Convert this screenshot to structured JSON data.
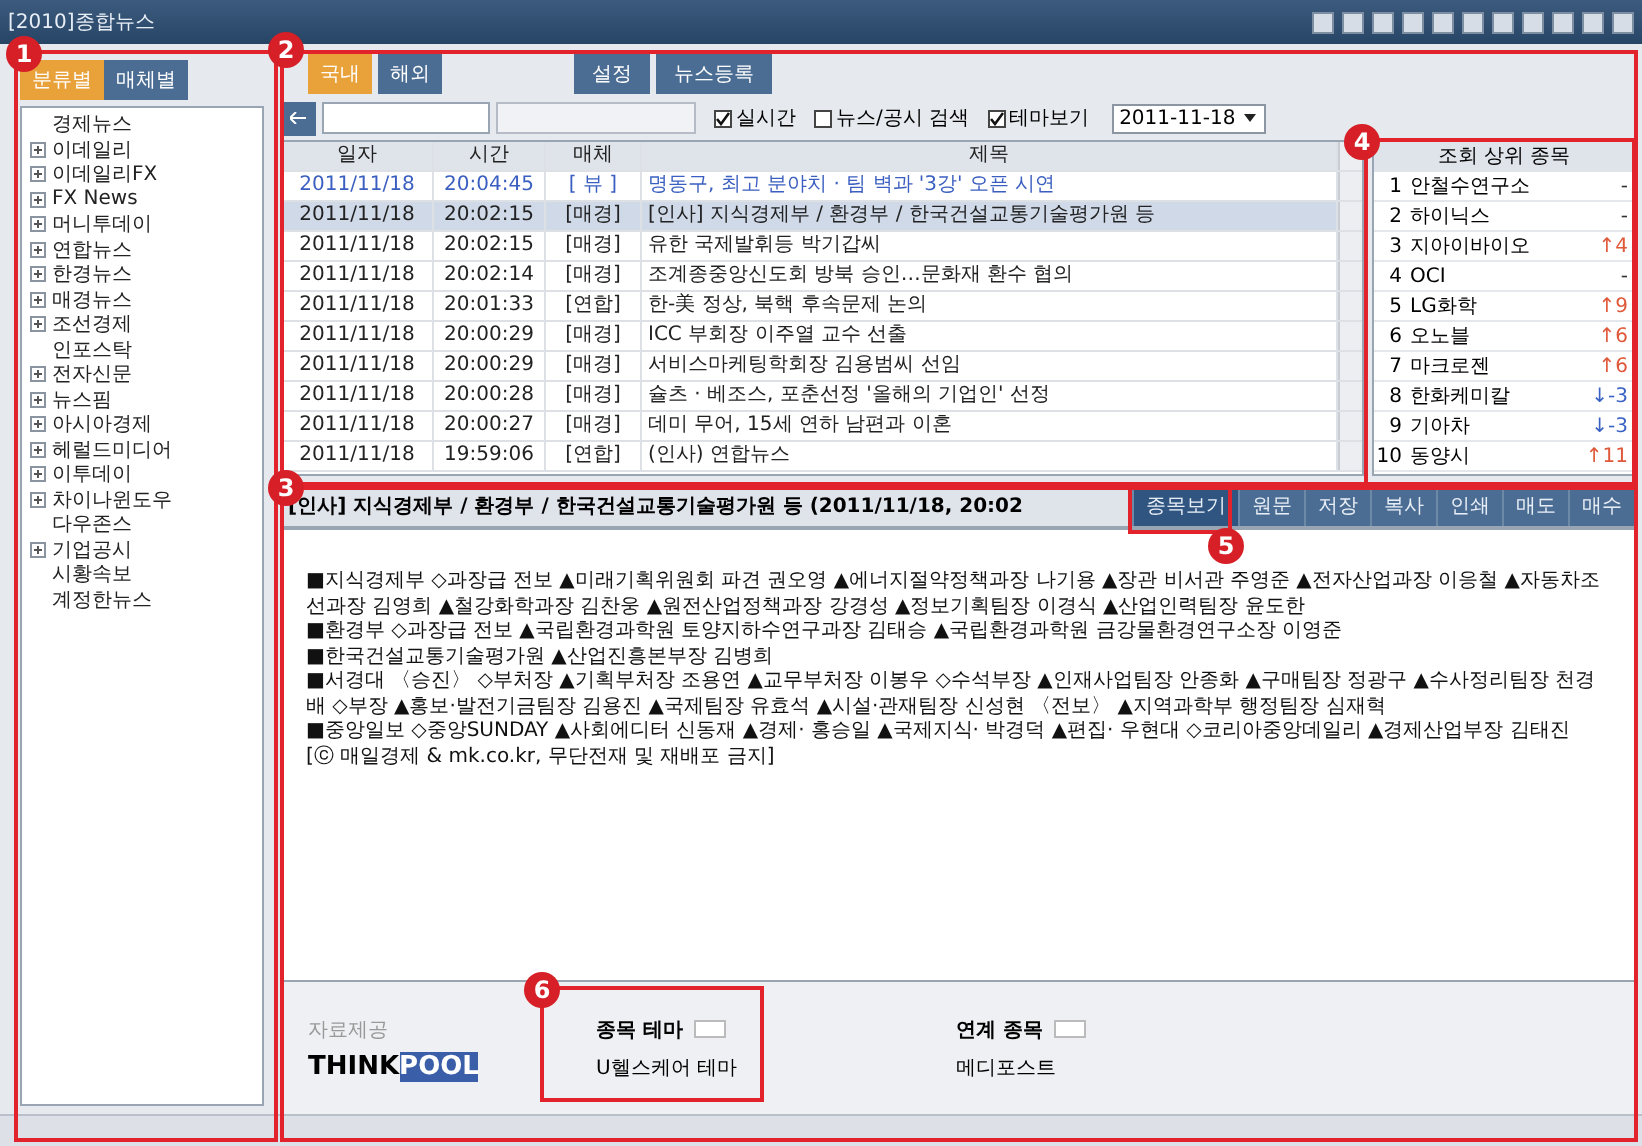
{
  "window": {
    "title": "[2010]종합뉴스"
  },
  "sidebar": {
    "tabs": [
      {
        "label": "분류별",
        "selected": true
      },
      {
        "label": "매체별",
        "selected": false
      }
    ],
    "items": [
      {
        "label": "경제뉴스",
        "expandable": false
      },
      {
        "label": "이데일리",
        "expandable": true
      },
      {
        "label": "이데일리FX",
        "expandable": true
      },
      {
        "label": "FX News",
        "expandable": true
      },
      {
        "label": "머니투데이",
        "expandable": true
      },
      {
        "label": "연합뉴스",
        "expandable": true
      },
      {
        "label": "한경뉴스",
        "expandable": true
      },
      {
        "label": "매경뉴스",
        "expandable": true
      },
      {
        "label": "조선경제",
        "expandable": true
      },
      {
        "label": "인포스탁",
        "expandable": false
      },
      {
        "label": "전자신문",
        "expandable": true
      },
      {
        "label": "뉴스핌",
        "expandable": true
      },
      {
        "label": "아시아경제",
        "expandable": true
      },
      {
        "label": "헤럴드미디어",
        "expandable": true
      },
      {
        "label": "이투데이",
        "expandable": true
      },
      {
        "label": "차이나윈도우",
        "expandable": true
      },
      {
        "label": "다우존스",
        "expandable": false
      },
      {
        "label": "기업공시",
        "expandable": true
      },
      {
        "label": "시황속보",
        "expandable": false
      },
      {
        "label": "계정한뉴스",
        "expandable": false
      }
    ]
  },
  "toolbar": {
    "tabs": [
      {
        "label": "국내",
        "selected": true
      },
      {
        "label": "해외",
        "selected": false
      }
    ],
    "buttons": [
      "설정",
      "뉴스등록"
    ],
    "checkboxes": [
      {
        "label": "실시간",
        "checked": true
      },
      {
        "label": "뉴스/공시 검색",
        "checked": false
      },
      {
        "label": "테마보기",
        "checked": true
      }
    ],
    "date": "2011-11-18"
  },
  "news_table": {
    "columns": [
      "일자",
      "시간",
      "매체",
      "제목"
    ],
    "rows": [
      {
        "date": "2011/11/18",
        "time": "20:04:45",
        "source": "[ 뷰 ]",
        "title": "명동구, 최고 분야치 · 팀 벽과 '3강' 오픈 시연",
        "unread": true,
        "selected": false
      },
      {
        "date": "2011/11/18",
        "time": "20:02:15",
        "source": "[매경]",
        "title": "[인사] 지식경제부 / 환경부 / 한국건설교통기술평가원 등",
        "unread": false,
        "selected": true
      },
      {
        "date": "2011/11/18",
        "time": "20:02:15",
        "source": "[매경]",
        "title": "유한 국제발휘등 박기갑씨",
        "unread": false,
        "selected": false
      },
      {
        "date": "2011/11/18",
        "time": "20:02:14",
        "source": "[매경]",
        "title": "조계종중앙신도회 방북 승인…문화재 환수 협의",
        "unread": false,
        "selected": false
      },
      {
        "date": "2011/11/18",
        "time": "20:01:33",
        "source": "[연합]",
        "title": "한-美 정상, 북핵 후속문제 논의",
        "unread": false,
        "selected": false
      },
      {
        "date": "2011/11/18",
        "time": "20:00:29",
        "source": "[매경]",
        "title": "ICC 부회장 이주열 교수 선출",
        "unread": false,
        "selected": false
      },
      {
        "date": "2011/11/18",
        "time": "20:00:29",
        "source": "[매경]",
        "title": "서비스마케팅학회장 김용범씨 선임",
        "unread": false,
        "selected": false
      },
      {
        "date": "2011/11/18",
        "time": "20:00:28",
        "source": "[매경]",
        "title": "슐츠 · 베조스, 포춘선정 '올해의 기업인' 선정",
        "unread": false,
        "selected": false
      },
      {
        "date": "2011/11/18",
        "time": "20:00:27",
        "source": "[매경]",
        "title": "데미 무어, 15세 연하 남편과 이혼",
        "unread": false,
        "selected": false
      },
      {
        "date": "2011/11/18",
        "time": "19:59:06",
        "source": "[연합]",
        "title": "(인사) 연합뉴스",
        "unread": false,
        "selected": false
      }
    ]
  },
  "ranking": {
    "title": "조회 상위 종목",
    "rows": [
      {
        "rank": "1",
        "name": "안철수연구소",
        "change": "-",
        "color": "#333333"
      },
      {
        "rank": "2",
        "name": "하이닉스",
        "change": "-",
        "color": "#333333"
      },
      {
        "rank": "3",
        "name": "지아이바이오",
        "change": "↑4",
        "color": "#e0583a"
      },
      {
        "rank": "4",
        "name": "OCI",
        "change": "-",
        "color": "#333333"
      },
      {
        "rank": "5",
        "name": "LG화학",
        "change": "↑9",
        "color": "#e0583a"
      },
      {
        "rank": "6",
        "name": "오노블",
        "change": "↑6",
        "color": "#e0583a"
      },
      {
        "rank": "7",
        "name": "마크로젠",
        "change": "↑6",
        "color": "#e0583a"
      },
      {
        "rank": "8",
        "name": "한화케미칼",
        "change": "↓-3",
        "color": "#3b63c4"
      },
      {
        "rank": "9",
        "name": "기아차",
        "change": "↓-3",
        "color": "#3b63c4"
      },
      {
        "rank": "10",
        "name": "동양시",
        "change": "↑11",
        "color": "#e0583a"
      }
    ]
  },
  "article": {
    "title": "[인사] 지식경제부 / 환경부 / 한국건설교통기술평가원 등 (2011/11/18, 20:02",
    "buttons": [
      {
        "label": "종목보기",
        "selected": true
      },
      {
        "label": "원문",
        "selected": false
      },
      {
        "label": "저장",
        "selected": false
      },
      {
        "label": "복사",
        "selected": false
      },
      {
        "label": "인쇄",
        "selected": false
      },
      {
        "label": "매도",
        "selected": false
      },
      {
        "label": "매수",
        "selected": false
      }
    ],
    "paragraphs": [
      "■지식경제부 ◇과장급 전보 ▲미래기획위원회 파견 권오영 ▲에너지절약정책과장 나기용 ▲장관 비서관 주영준 ▲전자산업과장 이응철 ▲자동차조선과장 김영희 ▲철강화학과장 김찬웅 ▲원전산업정책과장 강경성 ▲정보기획팀장 이경식 ▲산업인력팀장 윤도한",
      "■환경부 ◇과장급 전보 ▲국립환경과학원 토양지하수연구과장 김태승 ▲국립환경과학원 금강물환경연구소장 이영준",
      "■한국건설교통기술평가원 ▲산업진흥본부장 김병희",
      "■서경대 〈승진〉 ◇부처장 ▲기획부처장 조용연 ▲교무부처장 이봉우 ◇수석부장 ▲인재사업팀장 안종화 ▲구매팀장 정광구 ▲수사정리팀장 천경배 ◇부장 ▲홍보·발전기금팀장 김용진 ▲국제팀장 유효석 ▲시설·관재팀장 신성현 〈전보〉 ▲지역과학부 행정팀장 심재혁",
      "■중앙일보 ◇중앙SUNDAY ▲사회에디터 신동재 ▲경제· 홍승일 ▲국제지식· 박경덕 ▲편집· 우현대 ◇코리아중앙데일리 ▲경제산업부장 김태진",
      "[ⓒ 매일경제 & mk.co.kr, 무단전재 및 재배포 금지]"
    ],
    "provider_label": "자료제공",
    "logo": [
      "THINK",
      "POOL"
    ],
    "related": [
      {
        "heading": "종목 테마",
        "value": "U헬스케어 테마"
      },
      {
        "heading": "연계 종목",
        "value": "메디포스트"
      }
    ]
  },
  "callouts": [
    "1",
    "2",
    "3",
    "4",
    "5",
    "6"
  ]
}
